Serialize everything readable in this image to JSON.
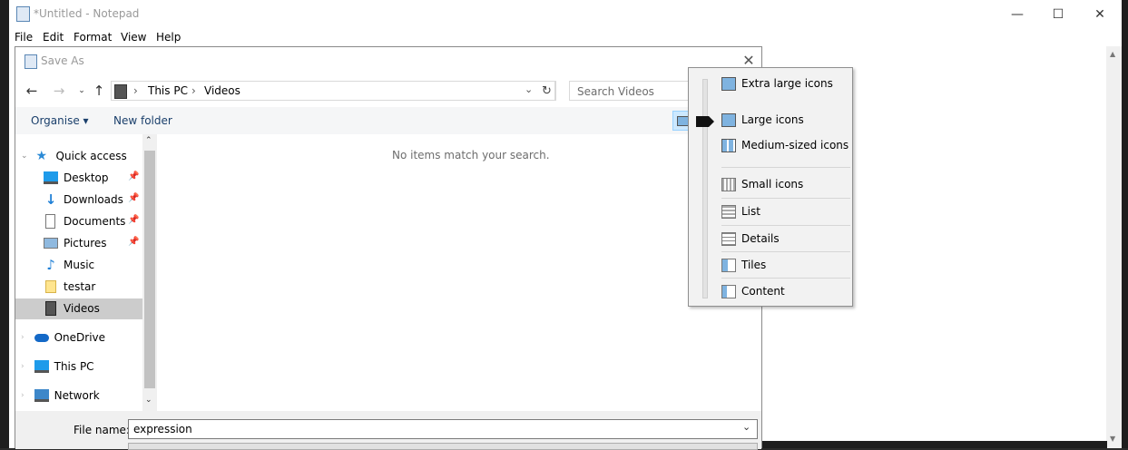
{
  "notepad": {
    "title": "*Untitled - Notepad",
    "menu": [
      "File",
      "Edit",
      "Format",
      "View",
      "Help"
    ],
    "caption_buttons": {
      "minimize": "—",
      "maximize": "☐",
      "close": "✕"
    }
  },
  "dialog": {
    "title": "Save As",
    "close": "✕",
    "breadcrumb": [
      "This PC",
      "Videos"
    ],
    "search_placeholder": "Search Videos",
    "toolbar": {
      "organise": "Organise ▾",
      "new_folder": "New folder"
    },
    "empty_message": "No items match your search.",
    "nav": {
      "quick_access": "Quick access",
      "items": [
        {
          "label": "Desktop",
          "pinned": true,
          "icon": "desktop-icon"
        },
        {
          "label": "Downloads",
          "pinned": true,
          "icon": "downloads-icon"
        },
        {
          "label": "Documents",
          "pinned": true,
          "icon": "documents-icon"
        },
        {
          "label": "Pictures",
          "pinned": true,
          "icon": "pictures-icon"
        },
        {
          "label": "Music",
          "pinned": false,
          "icon": "music-icon"
        },
        {
          "label": "testar",
          "pinned": false,
          "icon": "folder-icon"
        },
        {
          "label": "Videos",
          "pinned": false,
          "icon": "videos-icon",
          "selected": true
        }
      ],
      "onedrive": "OneDrive",
      "this_pc": "This PC",
      "network": "Network"
    },
    "file_name_label": "File name:",
    "file_name_value": "expression"
  },
  "view_menu": {
    "items": [
      "Extra large icons",
      "Large icons",
      "Medium-sized icons",
      "Small icons",
      "List",
      "Details",
      "Tiles",
      "Content"
    ],
    "selected": "Large icons"
  }
}
